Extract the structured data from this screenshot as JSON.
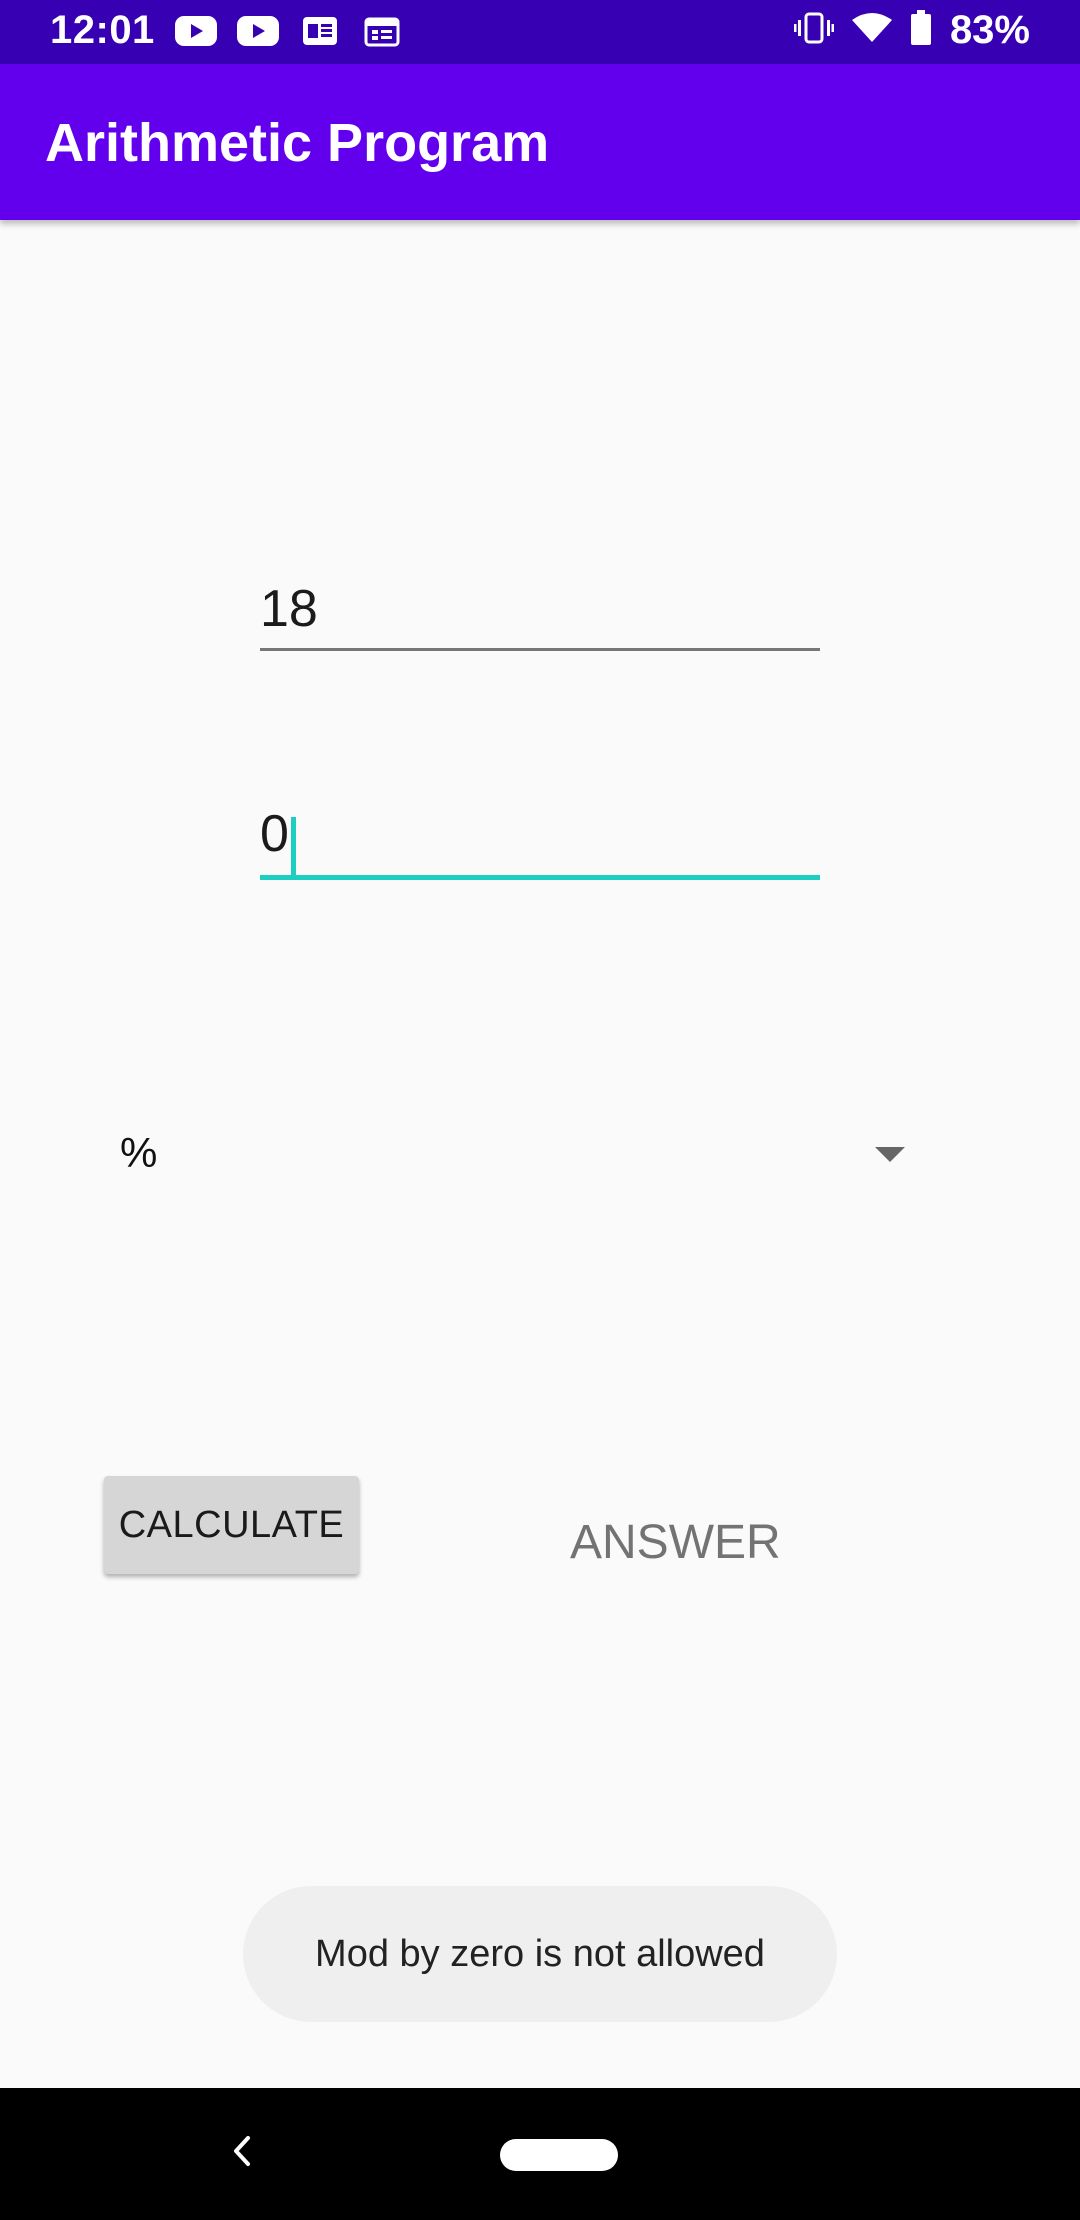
{
  "status_bar": {
    "time": "12:01",
    "battery_percent": "83%",
    "left_icons": [
      "youtube-icon",
      "youtube-icon",
      "news-icon",
      "calendar-icon"
    ],
    "right_icons": [
      "vibrate-icon",
      "wifi-icon",
      "battery-icon"
    ],
    "color": "#3700b3"
  },
  "app_bar": {
    "title": "Arithmetic Program",
    "color": "#6200ee"
  },
  "form": {
    "first_number": "18",
    "second_number": "0",
    "operator": "%",
    "accent_color": "#1ccfc0"
  },
  "actions": {
    "calculate_label": "CALCULATE",
    "answer_label": "ANSWER"
  },
  "toast": {
    "message": "Mod by zero is not allowed"
  },
  "nav_bar": {
    "icons": [
      "back-icon",
      "home-pill-icon"
    ]
  }
}
